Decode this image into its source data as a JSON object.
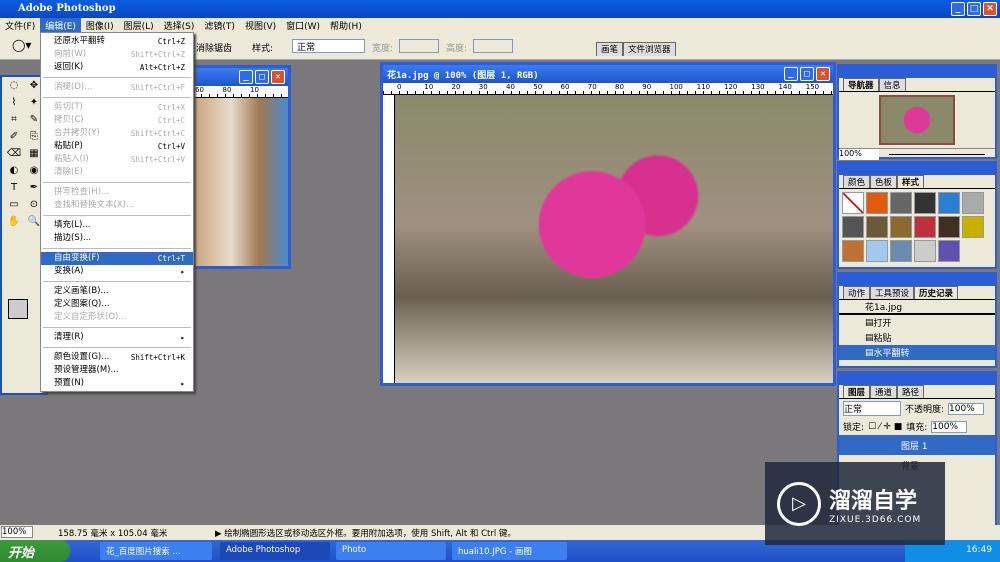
{
  "app": {
    "title": "Adobe Photoshop"
  },
  "menubar": [
    "文件(F)",
    "编辑(E)",
    "图像(I)",
    "图层(L)",
    "选择(S)",
    "滤镜(T)",
    "视图(V)",
    "窗口(W)",
    "帮助(H)"
  ],
  "options": {
    "antialias": "消除锯齿",
    "style_label": "样式:",
    "style_value": "正常",
    "width_label": "宽度:",
    "height_label": "高度:",
    "tabs": [
      "画笔",
      "文件浏览器"
    ]
  },
  "edit_menu": [
    {
      "label": "还原水平翻转",
      "shortcut": "Ctrl+Z",
      "disabled": false
    },
    {
      "label": "向前(W)",
      "shortcut": "Shift+Ctrl+Z",
      "disabled": true
    },
    {
      "label": "返回(K)",
      "shortcut": "Alt+Ctrl+Z",
      "disabled": false
    },
    {
      "sep": true
    },
    {
      "label": "消褪(D)...",
      "shortcut": "Shift+Ctrl+F",
      "disabled": true
    },
    {
      "sep": true
    },
    {
      "label": "剪切(T)",
      "shortcut": "Ctrl+X",
      "disabled": true
    },
    {
      "label": "拷贝(C)",
      "shortcut": "Ctrl+C",
      "disabled": true
    },
    {
      "label": "合并拷贝(Y)",
      "shortcut": "Shift+Ctrl+C",
      "disabled": true
    },
    {
      "label": "粘贴(P)",
      "shortcut": "Ctrl+V",
      "disabled": false
    },
    {
      "label": "粘贴入(I)",
      "shortcut": "Shift+Ctrl+V",
      "disabled": true
    },
    {
      "label": "清除(E)",
      "shortcut": "",
      "disabled": true
    },
    {
      "sep": true
    },
    {
      "label": "拼写检查(H)...",
      "shortcut": "",
      "disabled": true
    },
    {
      "label": "查找和替换文本(X)...",
      "shortcut": "",
      "disabled": true
    },
    {
      "sep": true
    },
    {
      "label": "填充(L)...",
      "shortcut": "",
      "disabled": false
    },
    {
      "label": "描边(S)...",
      "shortcut": "",
      "disabled": false
    },
    {
      "sep": true
    },
    {
      "label": "自由变换(F)",
      "shortcut": "Ctrl+T",
      "disabled": false,
      "selected": true
    },
    {
      "label": "变换(A)",
      "shortcut": "▸",
      "disabled": false
    },
    {
      "sep": true
    },
    {
      "label": "定义画笔(B)...",
      "shortcut": "",
      "disabled": false
    },
    {
      "label": "定义图案(Q)...",
      "shortcut": "",
      "disabled": false
    },
    {
      "label": "定义自定形状(O)...",
      "shortcut": "",
      "disabled": true
    },
    {
      "sep": true
    },
    {
      "label": "清理(R)",
      "shortcut": "▸",
      "disabled": false
    },
    {
      "sep": true
    },
    {
      "label": "颜色设置(G)...",
      "shortcut": "Shift+Ctrl+K",
      "disabled": false
    },
    {
      "label": "预设管理器(M)...",
      "shortcut": "",
      "disabled": false
    },
    {
      "label": "预置(N)",
      "shortcut": "▸",
      "disabled": false
    }
  ],
  "small_doc": {
    "ruler": [
      "60",
      "80",
      "10"
    ]
  },
  "main_doc": {
    "title": "花1a.jpg @ 100% (图层 1, RGB)",
    "ruler": [
      "0",
      "10",
      "20",
      "30",
      "40",
      "50",
      "60",
      "70",
      "80",
      "90",
      "100",
      "110",
      "120",
      "130",
      "140",
      "150"
    ]
  },
  "navigator": {
    "tabs": [
      "导航器",
      "信息"
    ],
    "zoom": "100%"
  },
  "styles": {
    "tabs": [
      "颜色",
      "色板",
      "样式"
    ],
    "swatches": [
      "#ffffff",
      "#e05a10",
      "#666666",
      "#333333",
      "#2a7fd0",
      "#aaaaaa",
      "#555555",
      "#6a5a3a",
      "#8a6a30",
      "#c0303a",
      "#403020",
      "#c8b000",
      "#c07030",
      "#a0c8f0",
      "#6a8ab0",
      "#cccccc",
      "#6050b0"
    ]
  },
  "history": {
    "tabs": [
      "动作",
      "工具预设",
      "历史记录"
    ],
    "snapshot": "花1a.jpg",
    "items": [
      "打开",
      "粘贴",
      "水平翻转"
    ]
  },
  "layers": {
    "tabs": [
      "图层",
      "通道",
      "路径"
    ],
    "mode": "正常",
    "opacity_label": "不透明度:",
    "opacity": "100%",
    "lock_label": "锁定:",
    "fill_label": "填充:",
    "fill": "100%",
    "items": [
      "图层 1",
      "背景"
    ]
  },
  "status": {
    "zoom": "100%",
    "size": "158.75 毫米 x 105.04 毫米",
    "hint": "绘制椭圆形选区或移动选区外框。要用附加选项，使用 Shift, Alt 和 Ctrl 键。"
  },
  "taskbar": {
    "start": "开始",
    "tasks": [
      "花_百度图片搜索 ...",
      "Adobe Photoshop",
      "Photo",
      "huali10.JPG - 画图"
    ],
    "clock": "16:49"
  },
  "watermark": {
    "name": "溜溜自学",
    "url": "ZIXUE.3D66.COM"
  }
}
